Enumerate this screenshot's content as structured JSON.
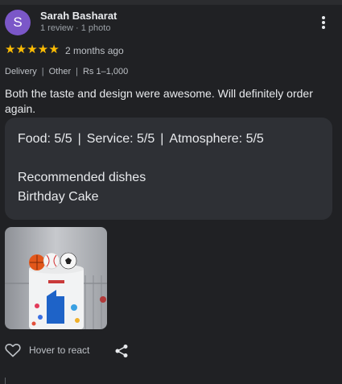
{
  "reviewer": {
    "initial": "S",
    "name": "Sarah Basharat",
    "stats": "1 review · 1 photo",
    "avatar_color": "#7b57c8"
  },
  "rating": {
    "stars": 5,
    "star_color": "#fbbc04",
    "when": "2 months ago"
  },
  "meta": [
    "Delivery",
    "Other",
    "Rs 1–1,000"
  ],
  "review_text": "Both the taste and design were awesome. Will definitely order again.",
  "details": {
    "food": "Food: 5/5",
    "service": "Service: 5/5",
    "atmosphere": "Atmosphere: 5/5",
    "recommended_heading": "Recommended dishes",
    "recommended_dish": "Birthday Cake"
  },
  "actions": {
    "react_label": "Hover to react"
  },
  "icons": [
    "more-vert-icon",
    "heart-icon",
    "share-icon"
  ]
}
